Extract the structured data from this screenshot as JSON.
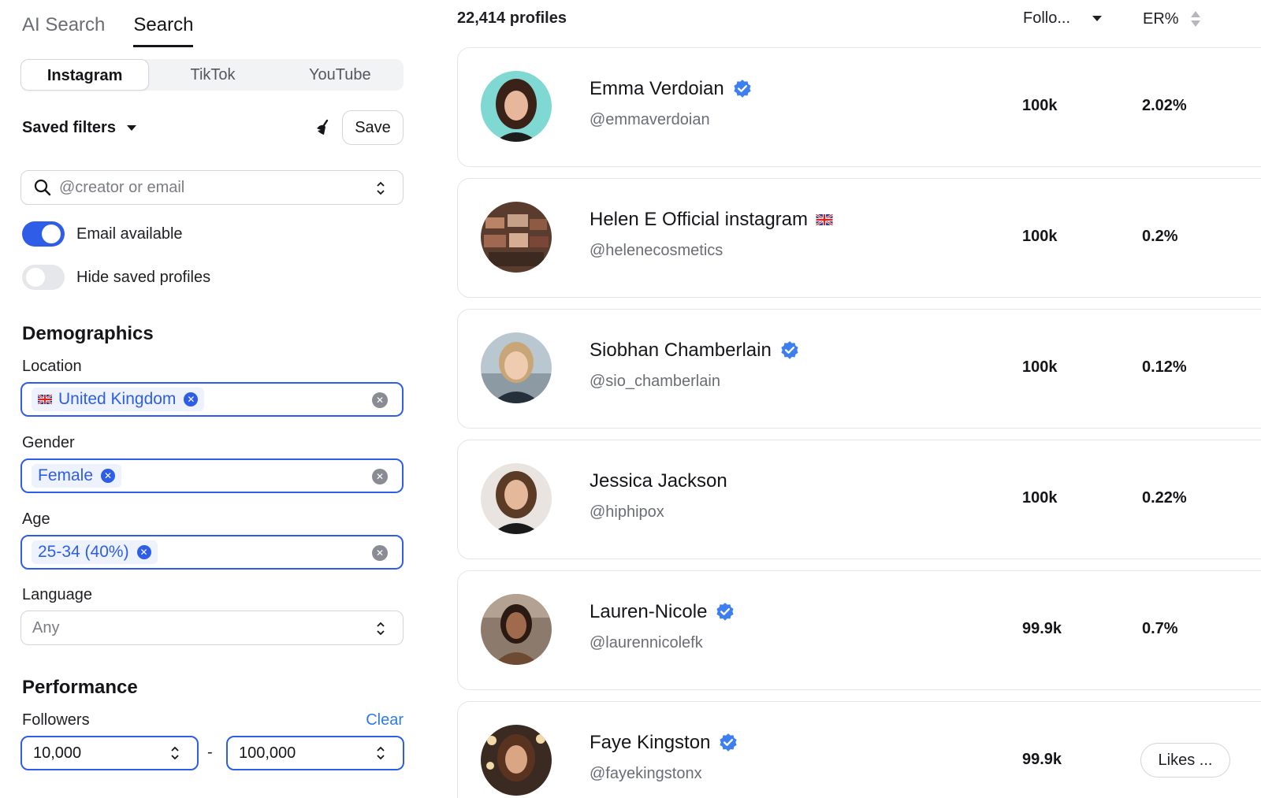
{
  "mode_tabs": {
    "ai_search": "AI Search",
    "search": "Search"
  },
  "platforms": {
    "instagram": "Instagram",
    "tiktok": "TikTok",
    "youtube": "YouTube"
  },
  "saved_filters": {
    "label": "Saved filters",
    "save_label": "Save"
  },
  "search": {
    "placeholder": "@creator or email",
    "value": ""
  },
  "toggles": {
    "email_available": "Email available",
    "hide_saved": "Hide saved profiles"
  },
  "demographics": {
    "title": "Demographics",
    "location": {
      "label": "Location",
      "chip": "United Kingdom"
    },
    "gender": {
      "label": "Gender",
      "chip": "Female"
    },
    "age": {
      "label": "Age",
      "chip": "25-34 (40%)"
    },
    "language": {
      "label": "Language",
      "value": "Any"
    }
  },
  "performance": {
    "title": "Performance",
    "followers_label": "Followers",
    "clear_label": "Clear",
    "min": "10,000",
    "max": "100,000",
    "dash": "-"
  },
  "results": {
    "count": "22,414 profiles",
    "sort_followers": "Follo...",
    "sort_er": "ER%",
    "profiles": [
      {
        "name": "Emma Verdoian",
        "handle": "@emmaverdoian",
        "followers": "100k",
        "er": "2.02%"
      },
      {
        "name": "Helen E Official instagram",
        "handle": "@helenecosmetics",
        "followers": "100k",
        "er": "0.2%"
      },
      {
        "name": "Siobhan Chamberlain",
        "handle": "@sio_chamberlain",
        "followers": "100k",
        "er": "0.12%"
      },
      {
        "name": "Jessica Jackson",
        "handle": "@hiphipox",
        "followers": "100k",
        "er": "0.22%"
      },
      {
        "name": "Lauren-Nicole",
        "handle": "@laurennicolefk",
        "followers": "99.9k",
        "er": "0.7%"
      },
      {
        "name": "Faye Kingston",
        "handle": "@fayekingstonx",
        "followers": "99.9k",
        "likes_label": "Likes ..."
      }
    ]
  },
  "colors": {
    "accent": "#2e5ee8",
    "verified": "#3d7ff0",
    "link": "#2e7be8"
  }
}
